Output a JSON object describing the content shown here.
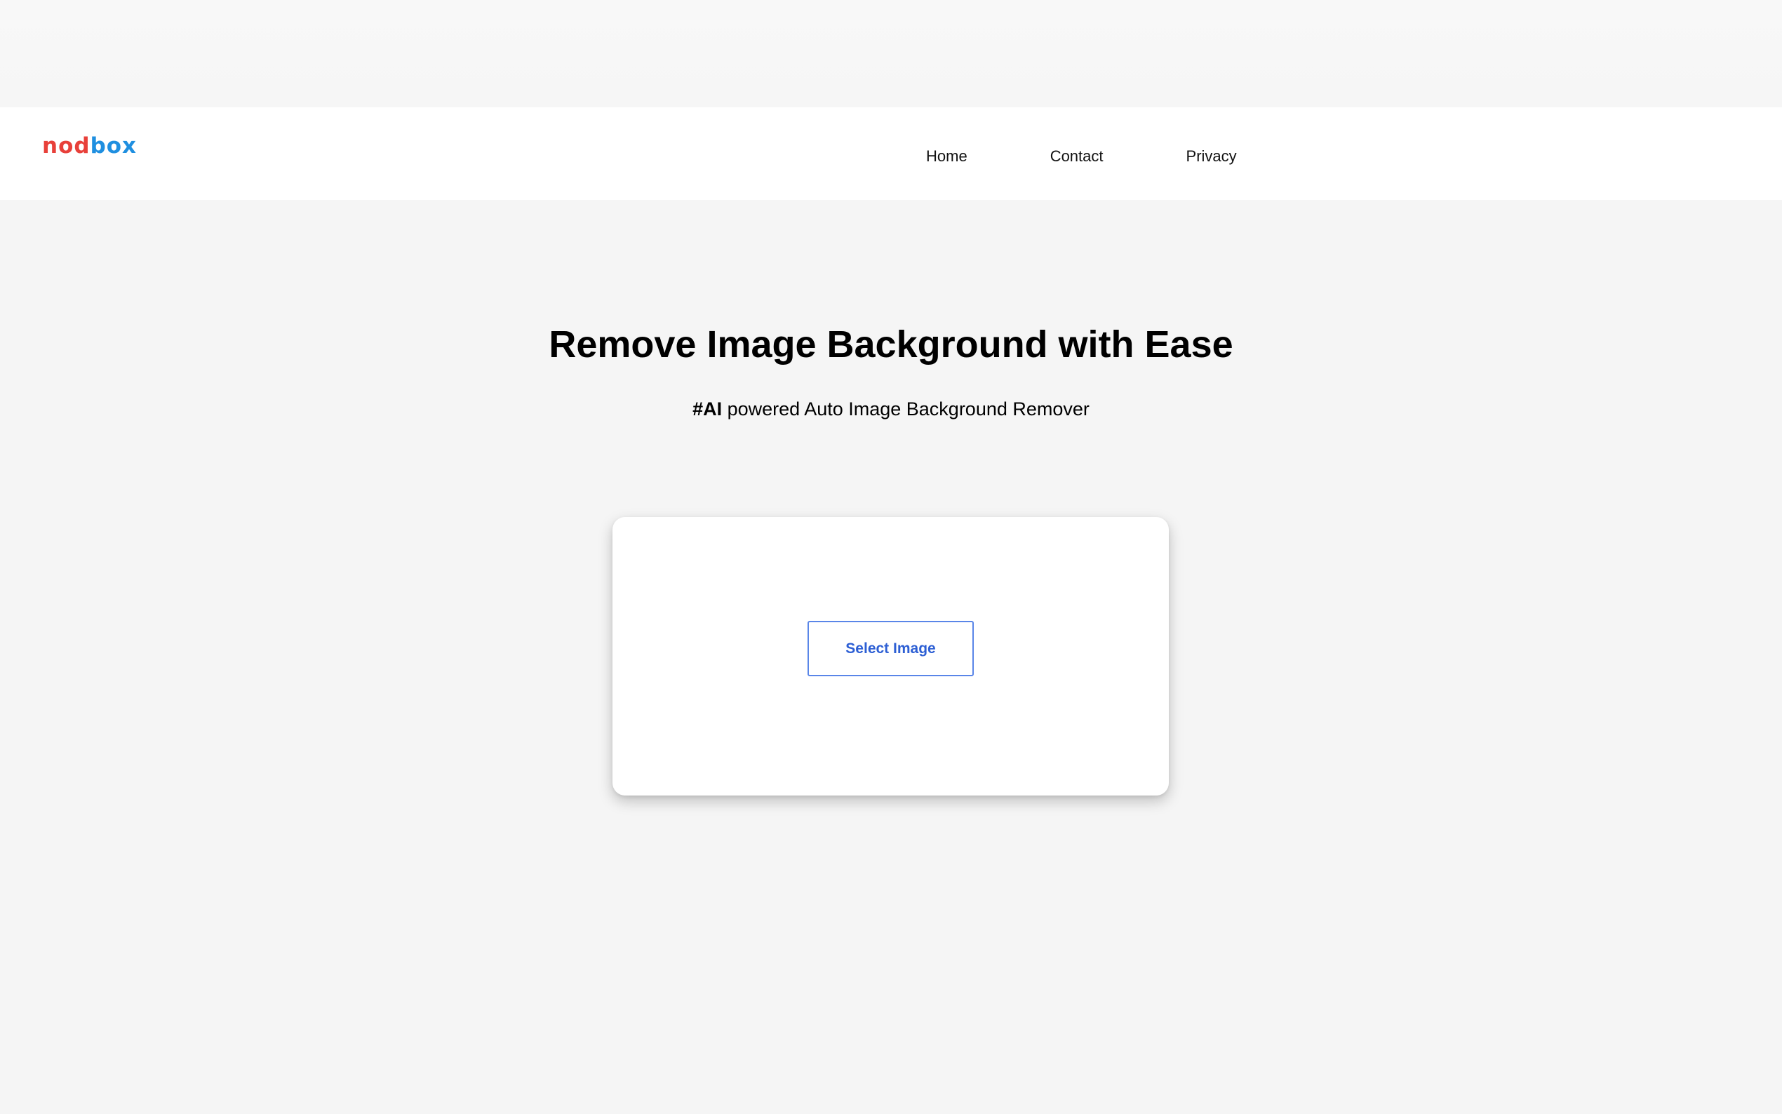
{
  "header": {
    "logo": {
      "part_a": "nod",
      "part_b": "box",
      "colors": {
        "part_a": "#e8403a",
        "part_b": "#1f8fe0"
      }
    },
    "nav": [
      {
        "label": "Home"
      },
      {
        "label": "Contact"
      },
      {
        "label": "Privacy"
      }
    ]
  },
  "hero": {
    "title": "Remove Image Background with Ease",
    "subtitle_tag": "#AI",
    "subtitle_rest": " powered Auto Image Background Remover"
  },
  "upload": {
    "button_label": "Select Image",
    "accent_color": "#2d5fd4"
  }
}
